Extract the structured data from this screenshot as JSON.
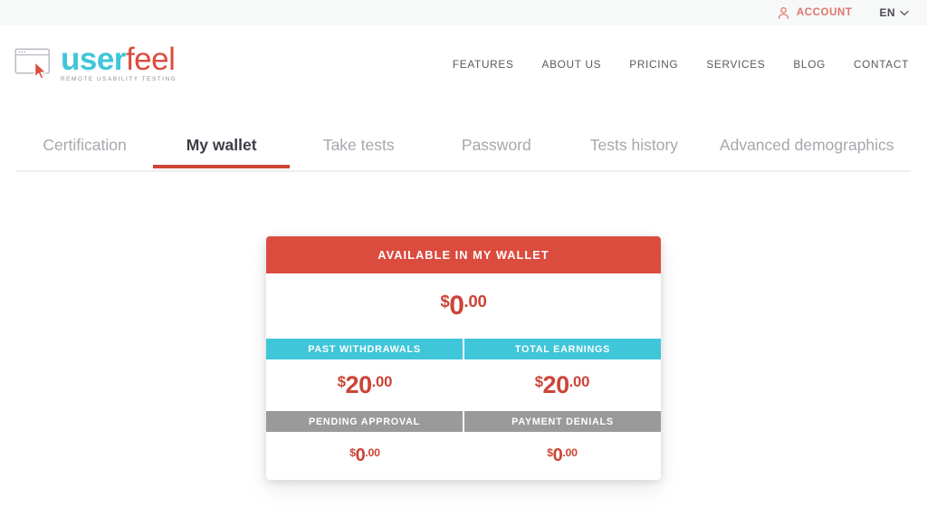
{
  "topbar": {
    "account_label": "ACCOUNT",
    "account_icon": "person-icon",
    "language": "EN",
    "chevron_icon": "chevron-down-icon"
  },
  "logo": {
    "word_user": "user",
    "word_feel": "feel",
    "tagline": "REMOTE USABILITY TESTING",
    "mark_icon": "browser-window-cursor-icon",
    "color_user": "#3fc6d9",
    "color_feel": "#dc4c3e"
  },
  "mainnav": {
    "items": [
      {
        "label": "FEATURES"
      },
      {
        "label": "ABOUT US"
      },
      {
        "label": "PRICING"
      },
      {
        "label": "SERVICES"
      },
      {
        "label": "BLOG"
      },
      {
        "label": "CONTACT"
      }
    ]
  },
  "tabs": {
    "active_index": 1,
    "items": [
      {
        "label": "Certification"
      },
      {
        "label": "My wallet"
      },
      {
        "label": "Take tests"
      },
      {
        "label": "Password"
      },
      {
        "label": "Tests history"
      },
      {
        "label": "Advanced demographics"
      }
    ],
    "active_underline_color": "#cc4436"
  },
  "wallet": {
    "title": "AVAILABLE IN MY WALLET",
    "title_bg": "#dc4c3e",
    "balance": {
      "currency": "$",
      "integer": "0",
      "decimal": ".00"
    },
    "teal_bg": "#3fc6d9",
    "gray_bg": "#9a9a9a",
    "amount_color": "#cc4436",
    "sections": [
      {
        "header_style": "teal",
        "cells": [
          {
            "label": "PAST WITHDRAWALS",
            "amount": {
              "currency": "$",
              "integer": "20",
              "decimal": ".00"
            }
          },
          {
            "label": "TOTAL EARNINGS",
            "amount": {
              "currency": "$",
              "integer": "20",
              "decimal": ".00"
            }
          }
        ]
      },
      {
        "header_style": "gray",
        "cells": [
          {
            "label": "PENDING APPROVAL",
            "amount": {
              "currency": "$",
              "integer": "0",
              "decimal": ".00"
            }
          },
          {
            "label": "PAYMENT DENIALS",
            "amount": {
              "currency": "$",
              "integer": "0",
              "decimal": ".00"
            }
          }
        ]
      }
    ]
  }
}
